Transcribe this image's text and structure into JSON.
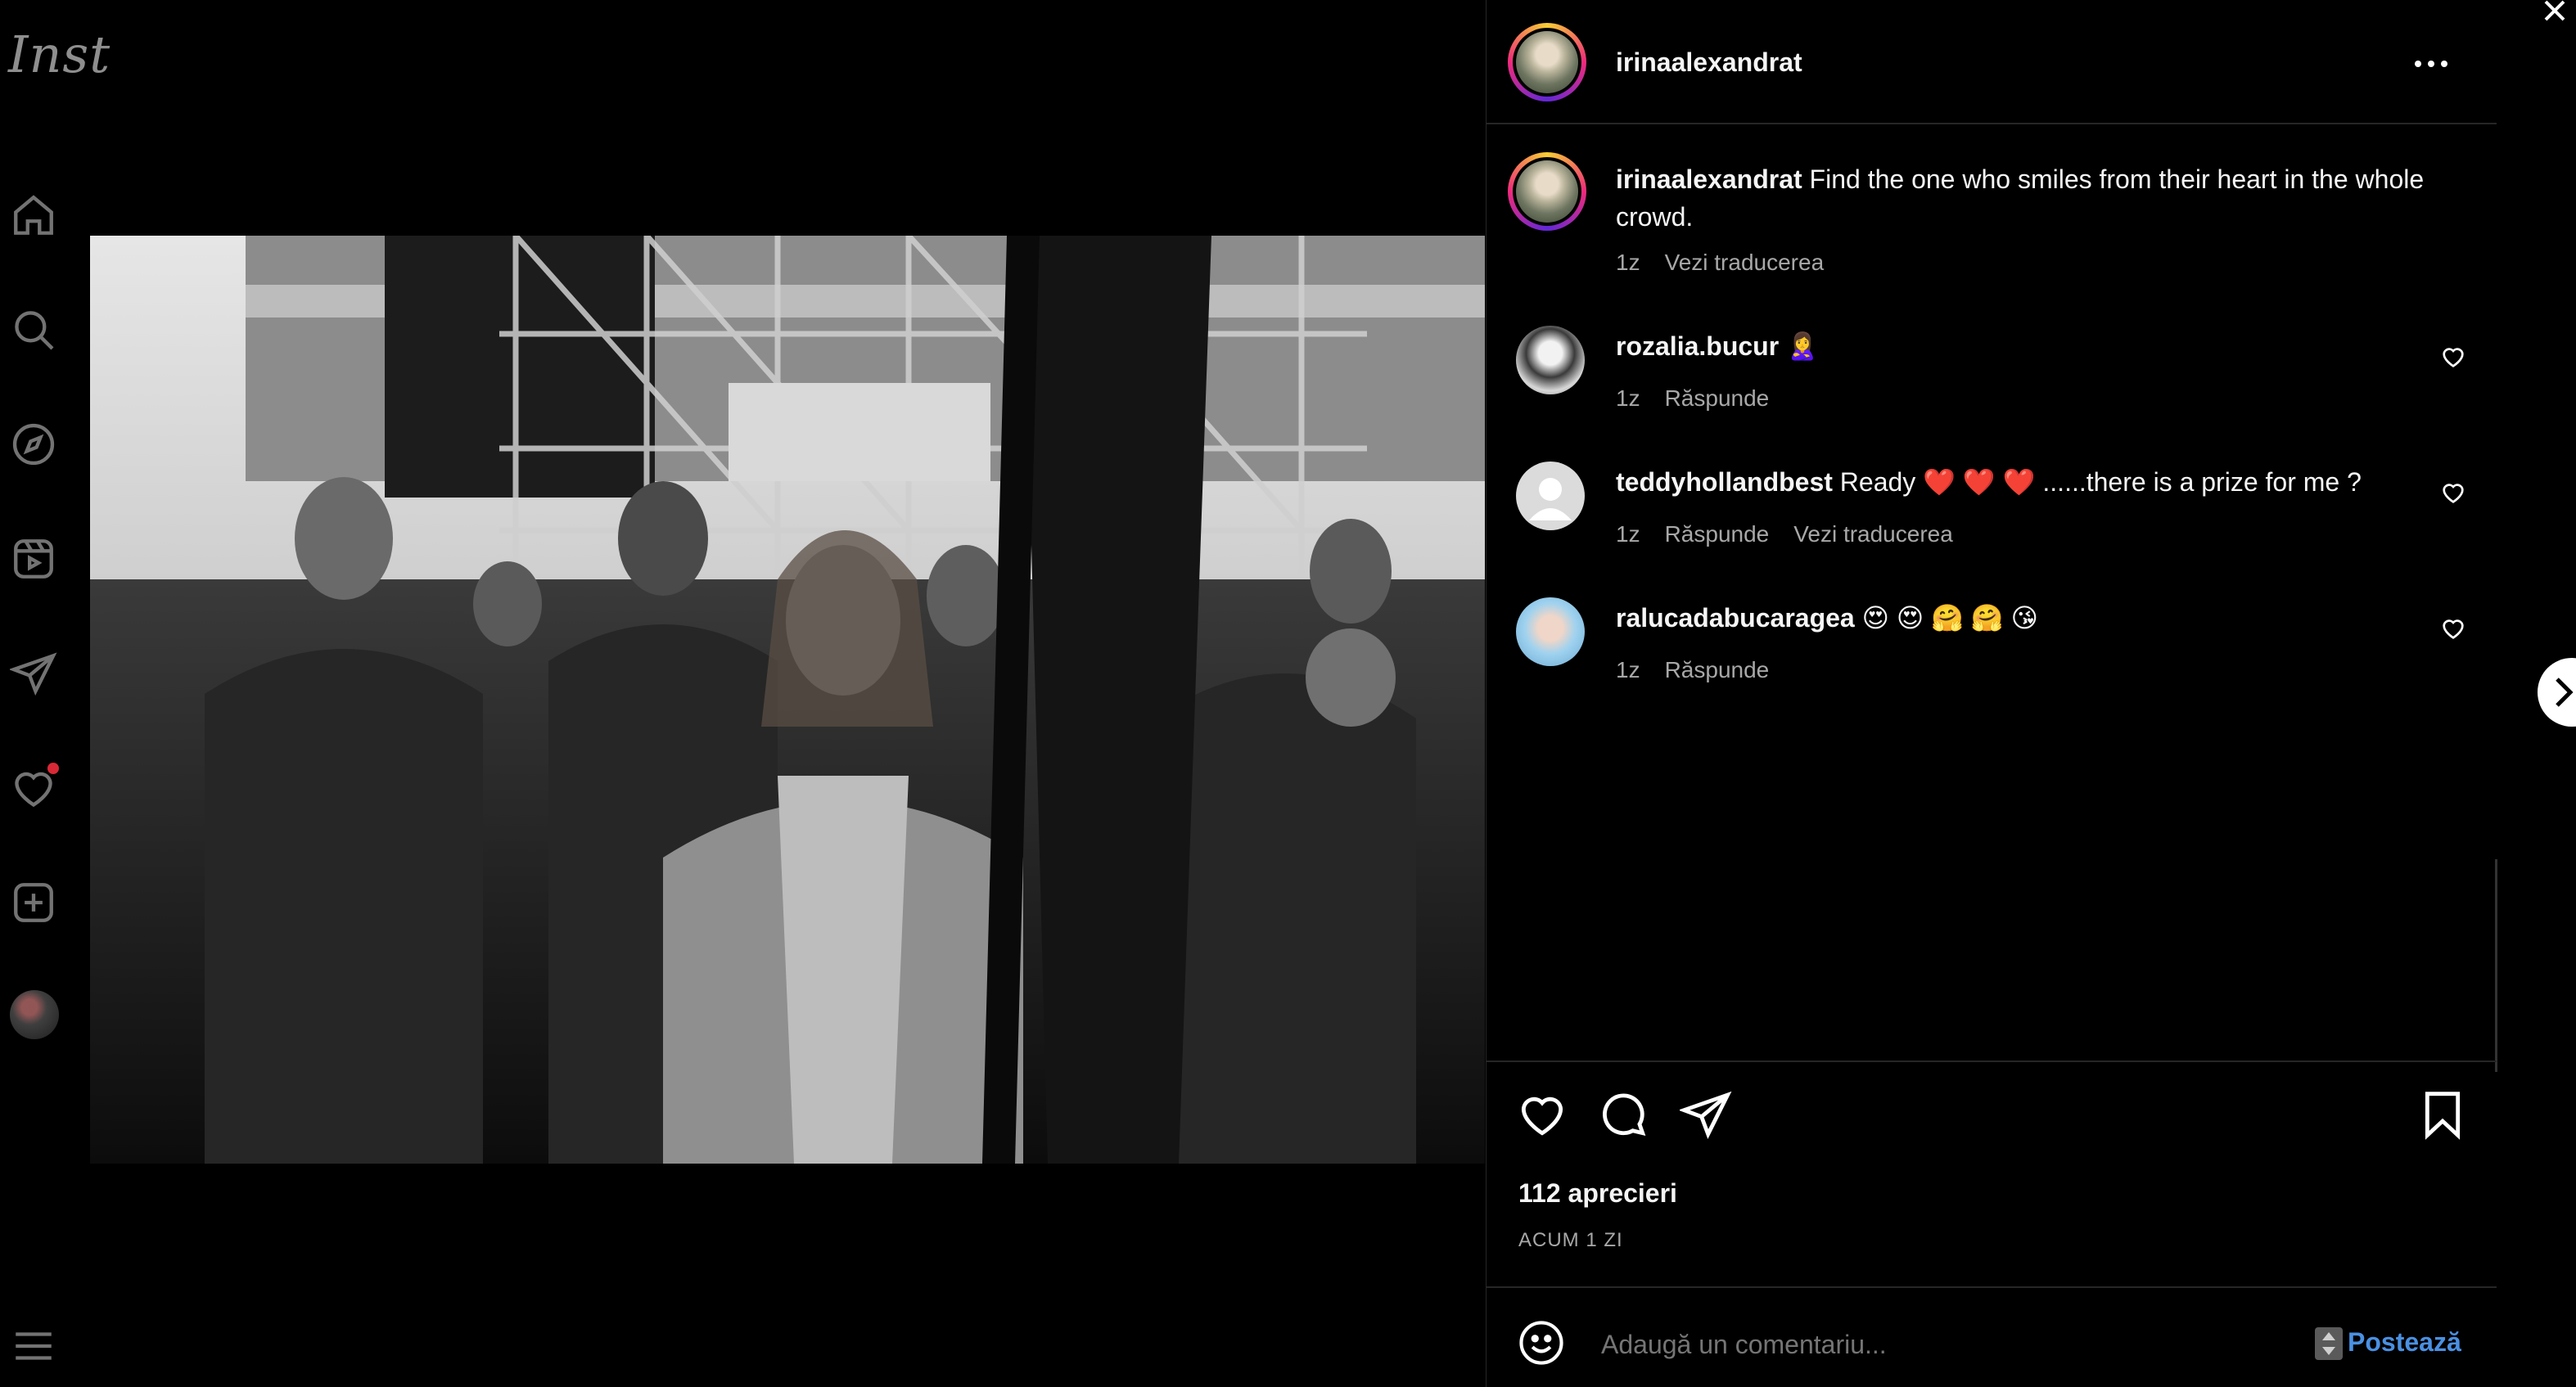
{
  "app": {
    "logo_text": "Inst"
  },
  "rail": {
    "icons": [
      "home-icon",
      "search-icon",
      "explore-icon",
      "reels-icon",
      "messages-icon",
      "notifications-icon",
      "create-icon",
      "profile-avatar",
      "menu-icon"
    ]
  },
  "post": {
    "author": "irinaalexandrat",
    "caption": "Find the one who smiles from their heart in the whole crowd.",
    "caption_time": "1z",
    "caption_translate": "Vezi traducerea",
    "likes": "112 aprecieri",
    "posted": "ACUM 1 ZI"
  },
  "comments": [
    {
      "user": "rozalia.bucur",
      "text": "🙎‍♀️",
      "time": "1z",
      "reply": "Răspunde"
    },
    {
      "user": "teddyhollandbest",
      "text": "Ready ❤️ ❤️ ❤️ ......there is a prize for me ?",
      "time": "1z",
      "reply": "Răspunde",
      "translate": "Vezi traducerea"
    },
    {
      "user": "ralucadabucaragea",
      "text": "😍 😍 🤗 🤗 😘",
      "time": "1z",
      "reply": "Răspunde"
    }
  ],
  "composer": {
    "placeholder": "Adaugă un comentariu...",
    "post_label": "Postează"
  },
  "colors": {
    "background": "#000000",
    "text": "#f5f5f5",
    "secondary": "#a8a8a8",
    "divider": "#262626",
    "notification": "#ff3040"
  }
}
